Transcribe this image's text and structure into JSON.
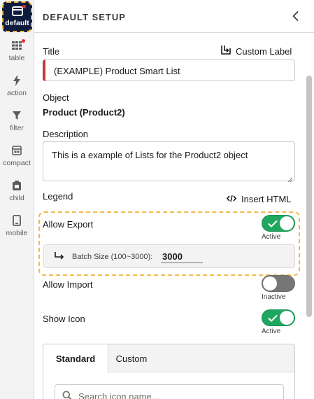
{
  "rail": {
    "items": [
      {
        "label": "default"
      },
      {
        "label": "table"
      },
      {
        "label": "action"
      },
      {
        "label": "filter"
      },
      {
        "label": "compact"
      },
      {
        "label": "child"
      },
      {
        "label": "mobile"
      }
    ]
  },
  "panel": {
    "title": "DEFAULT SETUP"
  },
  "form": {
    "title_label": "Title",
    "custom_label_action": "Custom Label",
    "title_value": "(EXAMPLE) Product Smart List",
    "object_label": "Object",
    "object_value": "Product (Product2)",
    "description_label": "Description",
    "description_value": "This is a example of Lists for the Product2 object",
    "legend_label": "Legend",
    "insert_html_action": "Insert HTML",
    "allow_export_label": "Allow Export",
    "allow_export_status": "Active",
    "allow_export_on": true,
    "batch_size_label": "Batch Size (100~3000):",
    "batch_size_value": "3000",
    "allow_import_label": "Allow Import",
    "allow_import_status": "Inactive",
    "allow_import_on": false,
    "show_icon_label": "Show Icon",
    "show_icon_status": "Active",
    "show_icon_on": true
  },
  "icon_picker": {
    "tabs": [
      "Standard",
      "Custom"
    ],
    "active_tab": "Standard",
    "search_placeholder": "Search icon name..."
  },
  "colors": {
    "rail_active_bg": "#0d1b3d",
    "highlight_dash": "#f2b94a",
    "toggle_on": "#1fa760",
    "toggle_off": "#767676",
    "required_bar": "#c23934"
  }
}
